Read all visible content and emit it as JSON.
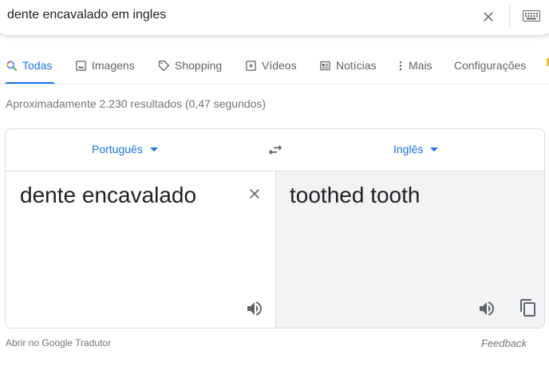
{
  "search": {
    "query": "dente encavalado em ingles"
  },
  "tabs": [
    {
      "label": "Todas",
      "icon": "search-icon",
      "active": true
    },
    {
      "label": "Imagens",
      "icon": "image-icon"
    },
    {
      "label": "Shopping",
      "icon": "tag-icon"
    },
    {
      "label": "Vídeos",
      "icon": "play-icon"
    },
    {
      "label": "Notícias",
      "icon": "news-icon"
    },
    {
      "label": "Mais",
      "icon": "more-vert-icon"
    },
    {
      "label": "Configurações"
    }
  ],
  "result_stats": "Aproximadamente 2.230 resultados (0,47 segundos)",
  "translator": {
    "source_lang": "Português",
    "target_lang": "Inglês",
    "source_text": "dente encavalado",
    "target_text": "toothed tooth"
  },
  "footer": {
    "open_link": "Abrir no Google Tradutor",
    "feedback": "Feedback"
  },
  "colors": {
    "accent": "#1a73e8",
    "muted": "#70757a",
    "target_bg": "#f1f3f4"
  }
}
